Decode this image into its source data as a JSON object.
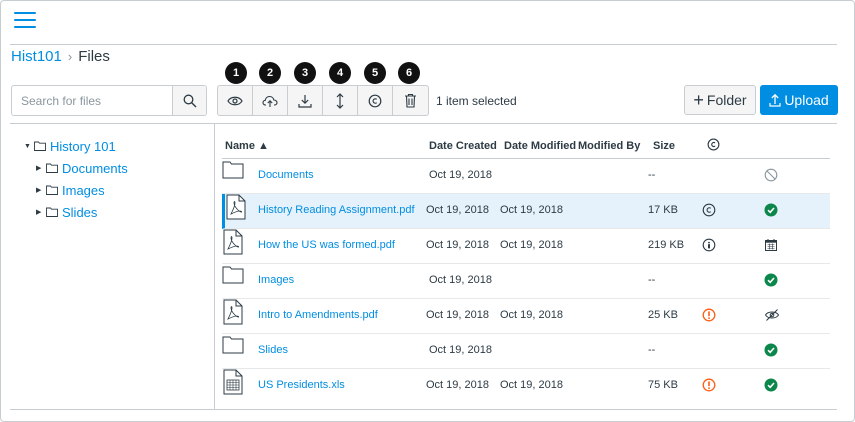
{
  "breadcrumb": {
    "course": "Hist101",
    "current": "Files"
  },
  "search": {
    "placeholder": "Search for files"
  },
  "toolbar": {
    "badges": [
      "1",
      "2",
      "3",
      "4",
      "5",
      "6"
    ],
    "selected_text": "1 item selected"
  },
  "actions": {
    "folder_label": "Folder",
    "upload_label": "Upload"
  },
  "tree": {
    "root": "History 101",
    "children": [
      "Documents",
      "Images",
      "Slides"
    ]
  },
  "table": {
    "headers": {
      "name": "Name ▲",
      "date_created": "Date Created",
      "date_modified": "Date Modified",
      "modified_by": "Modified By",
      "size": "Size"
    },
    "rows": [
      {
        "name": "Documents",
        "type": "folder",
        "date_created": "Oct 19, 2018",
        "date_modified": "",
        "size": "--",
        "usage": "",
        "status": "unpublished"
      },
      {
        "name": "History Reading Assignment.pdf",
        "type": "pdf",
        "date_created": "Oct 19, 2018",
        "date_modified": "Oct 19, 2018",
        "size": "17 KB",
        "usage": "copyright",
        "status": "published"
      },
      {
        "name": "How the US was formed.pdf",
        "type": "pdf",
        "date_created": "Oct 19, 2018",
        "date_modified": "Oct 19, 2018",
        "size": "219 KB",
        "usage": "creative-commons",
        "status": "scheduled"
      },
      {
        "name": "Images",
        "type": "folder",
        "date_created": "Oct 19, 2018",
        "date_modified": "",
        "size": "--",
        "usage": "",
        "status": "published"
      },
      {
        "name": "Intro to Amendments.pdf",
        "type": "pdf",
        "date_created": "Oct 19, 2018",
        "date_modified": "Oct 19, 2018",
        "size": "25 KB",
        "usage": "warning",
        "status": "hidden"
      },
      {
        "name": "Slides",
        "type": "folder",
        "date_created": "Oct 19, 2018",
        "date_modified": "",
        "size": "--",
        "usage": "",
        "status": "published"
      },
      {
        "name": "US Presidents.xls",
        "type": "xls",
        "date_created": "Oct 19, 2018",
        "date_modified": "Oct 19, 2018",
        "size": "75 KB",
        "usage": "warning",
        "status": "published"
      }
    ]
  },
  "colors": {
    "brand": "#008ee2",
    "success": "#0b874b",
    "warning": "#fc5e13",
    "border": "#c7cdd1",
    "selected_row": "#e6f2fb"
  }
}
